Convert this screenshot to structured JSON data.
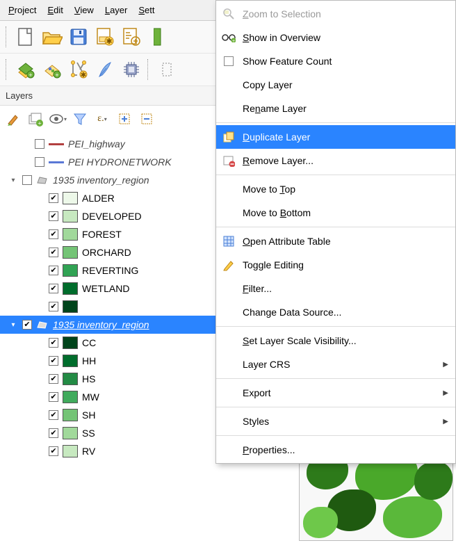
{
  "menubar": {
    "project": "Project",
    "edit": "Edit",
    "view": "View",
    "layer": "Layer",
    "settings": "Sett"
  },
  "panel": {
    "title": "Layers"
  },
  "layers": {
    "pei_highway": {
      "label": "PEI_highway",
      "color": "#b24040"
    },
    "pei_hydro": {
      "label": "PEI HYDRONETWORK",
      "color": "#5a78d6"
    },
    "inv35_1": {
      "label": "1935 inventory_region",
      "children": [
        {
          "label": "ALDER",
          "color": "#edf8e9"
        },
        {
          "label": "DEVELOPED",
          "color": "#c7e9c0"
        },
        {
          "label": "FOREST",
          "color": "#a1d99b"
        },
        {
          "label": "ORCHARD",
          "color": "#74c476"
        },
        {
          "label": "REVERTING",
          "color": "#31a354"
        },
        {
          "label": "WETLAND",
          "color": "#006d2c"
        },
        {
          "label": "",
          "color": "#00441b"
        }
      ]
    },
    "inv35_2": {
      "label": "1935 inventory_region",
      "children": [
        {
          "label": "CC",
          "color": "#00441b"
        },
        {
          "label": "HH",
          "color": "#006d2c"
        },
        {
          "label": "HS",
          "color": "#238b45"
        },
        {
          "label": "MW",
          "color": "#41ab5d"
        },
        {
          "label": "SH",
          "color": "#74c476"
        },
        {
          "label": "SS",
          "color": "#a1d99b"
        },
        {
          "label": "RV",
          "color": "#c7e9c0"
        }
      ]
    }
  },
  "ctx": {
    "zoom_selection": "Zoom to Selection",
    "show_overview": "Show in Overview",
    "show_feature_count": "Show Feature Count",
    "copy_layer": "Copy Layer",
    "rename_layer": "Rename Layer",
    "duplicate_layer": "Duplicate Layer",
    "remove_layer": "Remove Layer...",
    "move_top": "Move to Top",
    "move_bottom": "Move to Bottom",
    "open_attr_table": "Open Attribute Table",
    "toggle_editing": "Toggle Editing",
    "filter": "Filter...",
    "change_data_source": "Change Data Source...",
    "set_scale_vis": "Set Layer Scale Visibility...",
    "layer_crs": "Layer CRS",
    "export": "Export",
    "styles": "Styles",
    "properties": "Properties..."
  },
  "mnemonics": {
    "project": "P",
    "edit": "E",
    "view": "V",
    "layer": "L",
    "settings": "S",
    "zoom_selection": "Z",
    "show_overview": "S",
    "rename_layer": "n",
    "duplicate_layer": "D",
    "remove_layer": "R",
    "move_top": "T",
    "move_bottom": "B",
    "open_attr_table": "O",
    "filter": "F",
    "set_scale_vis": "S",
    "properties": "P"
  }
}
